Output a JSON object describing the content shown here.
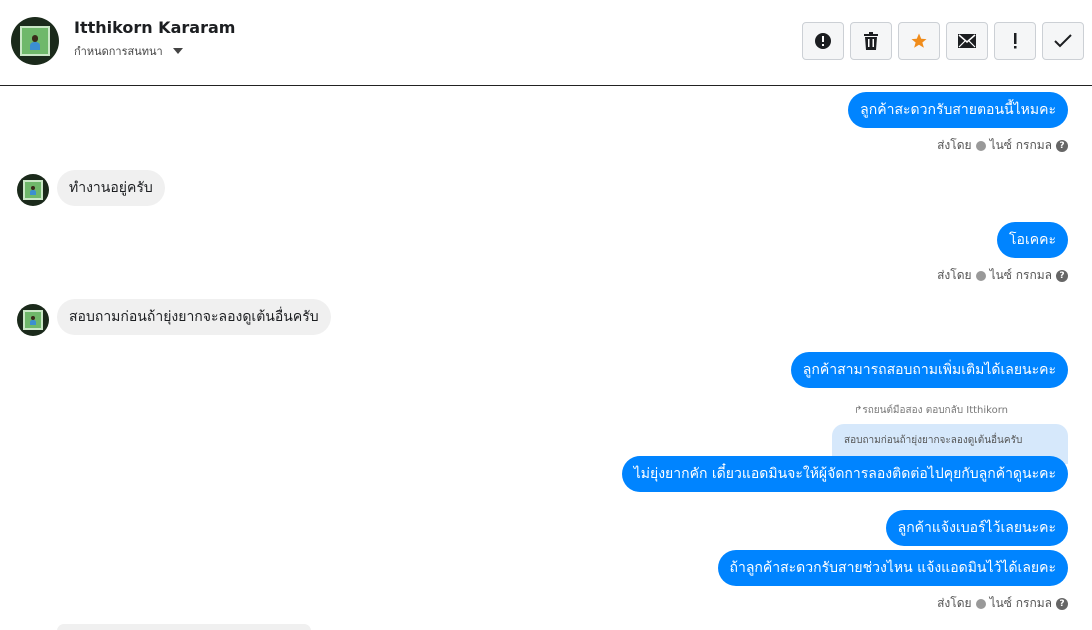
{
  "header": {
    "contact_name": "Itthikorn Kararam",
    "conversation_setting": "กำหนดการสนทนา"
  },
  "toolbar": {
    "items": [
      "alert-circle-icon",
      "trash-icon",
      "star-icon",
      "envelope-icon",
      "exclamation-icon",
      "check-icon"
    ],
    "star_color": "#f08c1b"
  },
  "messages": [
    {
      "direction": "out",
      "text": "ลูกค้าสะดวกรับสายตอนนี้ไหมคะ"
    },
    {
      "direction": "in",
      "text": "ทำงานอยู่ครับ"
    },
    {
      "direction": "out",
      "text": "โอเคคะ"
    },
    {
      "direction": "in",
      "text": "สอบถามก่อนถ้ายุ่งยากจะลองดูเต้นอื่นครับ"
    },
    {
      "direction": "out",
      "text": "ลูกค้าสามารถสอบถามเพิ่มเติมได้เลยนะคะ"
    },
    {
      "direction": "out",
      "text": "ไม่ยุ่งยากคัก เดี๋ยวแอดมินจะให้ผู้จัดการลองติดต่อไปคุยกับลูกค้าดูนะคะ"
    },
    {
      "direction": "out",
      "text": "ลูกค้าแจ้งเบอร์ไว้เลยนะคะ"
    },
    {
      "direction": "out",
      "text": "ถ้าลูกค้าสะดวกรับสายช่วงไหน แจ้งแอดมินไว้ได้เลยคะ"
    }
  ],
  "sent_by": {
    "label": "ส่งโดย",
    "agent": "ไนซ์ กรกมล"
  },
  "reply": {
    "note": "↱รถยนต์มือสอง ตอบกลับ Itthikorn",
    "quoted_text": "สอบถามก่อนถ้ายุ่งยากจะลองดูเต้นอื่นครับ"
  },
  "colors": {
    "outgoing_bubble": "#0084ff",
    "incoming_bubble": "#f0f0f0",
    "reply_quote": "#d6e8fb"
  }
}
